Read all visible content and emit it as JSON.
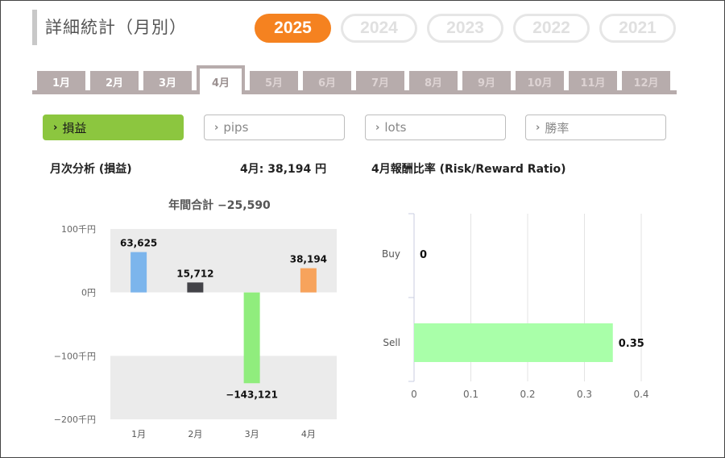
{
  "header": {
    "title": "詳細統計（月別）",
    "years": [
      {
        "label": "2025",
        "active": true
      },
      {
        "label": "2024",
        "active": false
      },
      {
        "label": "2023",
        "active": false
      },
      {
        "label": "2022",
        "active": false
      },
      {
        "label": "2021",
        "active": false
      }
    ]
  },
  "months": [
    {
      "label": "1月",
      "state": "past"
    },
    {
      "label": "2月",
      "state": "past"
    },
    {
      "label": "3月",
      "state": "past"
    },
    {
      "label": "4月",
      "state": "current"
    },
    {
      "label": "5月",
      "state": "future"
    },
    {
      "label": "6月",
      "state": "future"
    },
    {
      "label": "7月",
      "state": "future"
    },
    {
      "label": "8月",
      "state": "future"
    },
    {
      "label": "9月",
      "state": "future"
    },
    {
      "label": "10月",
      "state": "future"
    },
    {
      "label": "11月",
      "state": "future"
    },
    {
      "label": "12月",
      "state": "future"
    }
  ],
  "metrics": [
    {
      "label": "損益",
      "active": true,
      "chevron": "›"
    },
    {
      "label": "pips",
      "active": false,
      "chevron": "›"
    },
    {
      "label": "lots",
      "active": false,
      "chevron": "›"
    },
    {
      "label": "勝率",
      "active": false,
      "chevron": "›"
    }
  ],
  "analysis": {
    "monthly_heading": "月次分析 (損益)",
    "month_summary": "4月:  38,194 円",
    "ratio_heading": "4月報酬比率 (Risk/Reward Ratio)"
  },
  "colors": {
    "accent": "#f58220",
    "active_metric": "#8cc63f",
    "tab": "#b7acac"
  },
  "chart_data": [
    {
      "type": "bar",
      "title": "年間合計 −25,590",
      "categories": [
        "1月",
        "2月",
        "3月",
        "4月"
      ],
      "values": [
        63625,
        15712,
        -143121,
        38194
      ],
      "value_labels": [
        "63,625",
        "15,712",
        "−143,121",
        "38,194"
      ],
      "colors": [
        "#7cb5ec",
        "#434348",
        "#90ed7d",
        "#f7a35c"
      ],
      "ylim": [
        -200000,
        100000
      ],
      "yticks": [
        100000,
        0,
        -100000,
        -200000
      ],
      "ytick_labels": [
        "100千円",
        "0円",
        "−100千円",
        "−200千円"
      ],
      "grid": "alternating bands"
    },
    {
      "type": "bar",
      "orientation": "horizontal",
      "categories": [
        "Buy",
        "Sell"
      ],
      "values": [
        0,
        0.35
      ],
      "value_labels": [
        "0",
        "0.35"
      ],
      "color": "#a9ffa9",
      "xlim": [
        0,
        0.4
      ],
      "xticks": [
        0,
        0.1,
        0.2,
        0.3,
        0.4
      ],
      "xtick_labels": [
        "0",
        "0.1",
        "0.2",
        "0.3",
        "0.4"
      ],
      "grid": true
    }
  ]
}
